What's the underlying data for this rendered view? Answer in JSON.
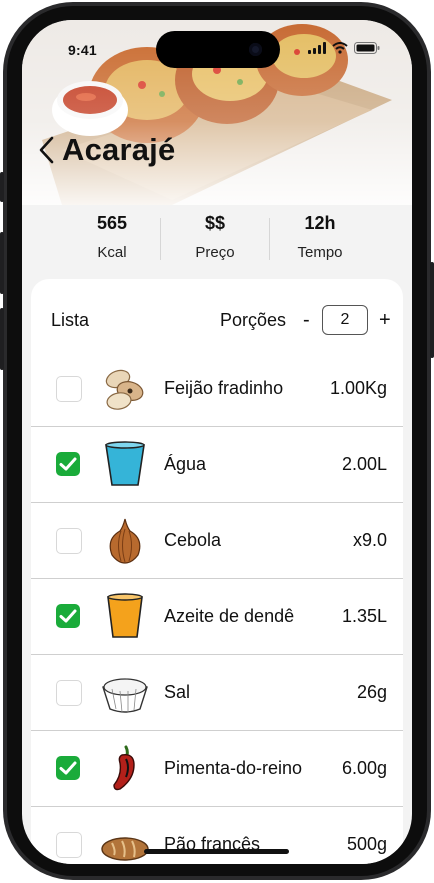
{
  "status_bar": {
    "time": "9:41"
  },
  "recipe": {
    "title": "Acarajé"
  },
  "stats": [
    {
      "value": "565",
      "label": "Kcal"
    },
    {
      "value": "$$",
      "label": "Preço"
    },
    {
      "value": "12h",
      "label": "Tempo"
    }
  ],
  "list": {
    "title": "Lista",
    "portions_label": "Porções",
    "minus_label": "-",
    "plus_label": "+",
    "portions_value": "2"
  },
  "ingredients": [
    {
      "name": "Feijão fradinho",
      "quantity": "1.00Kg",
      "checked": false,
      "icon": "beans-icon"
    },
    {
      "name": "Água",
      "quantity": "2.00L",
      "checked": true,
      "icon": "water-cup-icon"
    },
    {
      "name": "Cebola",
      "quantity": "x9.0",
      "checked": false,
      "icon": "onion-icon"
    },
    {
      "name": "Azeite de dendê",
      "quantity": "1.35L",
      "checked": true,
      "icon": "oil-cup-icon"
    },
    {
      "name": "Sal",
      "quantity": "26g",
      "checked": false,
      "icon": "salt-bowl-icon"
    },
    {
      "name": "Pimenta-do-reino",
      "quantity": "6.00g",
      "checked": true,
      "icon": "pepper-icon"
    },
    {
      "name": "Pão francês",
      "quantity": "500g",
      "checked": false,
      "icon": "bread-icon"
    }
  ],
  "colors": {
    "checked": "#1aab3a",
    "divider": "#cfcfcf",
    "background": "#f3f3f3"
  }
}
